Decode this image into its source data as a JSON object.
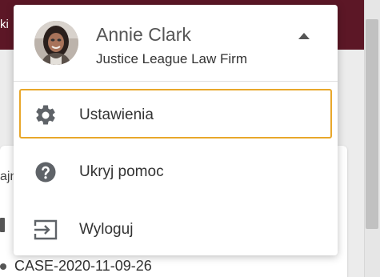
{
  "header": {
    "partial_text": "ki"
  },
  "background": {
    "cut_label": "ajn",
    "case_id": "CASE-2020-11-09-26"
  },
  "user": {
    "name": "Annie Clark",
    "organization": "Justice League Law Firm"
  },
  "menu": {
    "items": [
      {
        "label": "Ustawienia",
        "icon": "gear-icon"
      },
      {
        "label": "Ukryj pomoc",
        "icon": "help-circle-icon"
      },
      {
        "label": "Wyloguj",
        "icon": "logout-icon"
      }
    ]
  },
  "colors": {
    "header_bg": "#5c1726",
    "focus_outline": "#e8a72a",
    "icon_gray": "#5f6368",
    "text_dark": "#333333"
  }
}
